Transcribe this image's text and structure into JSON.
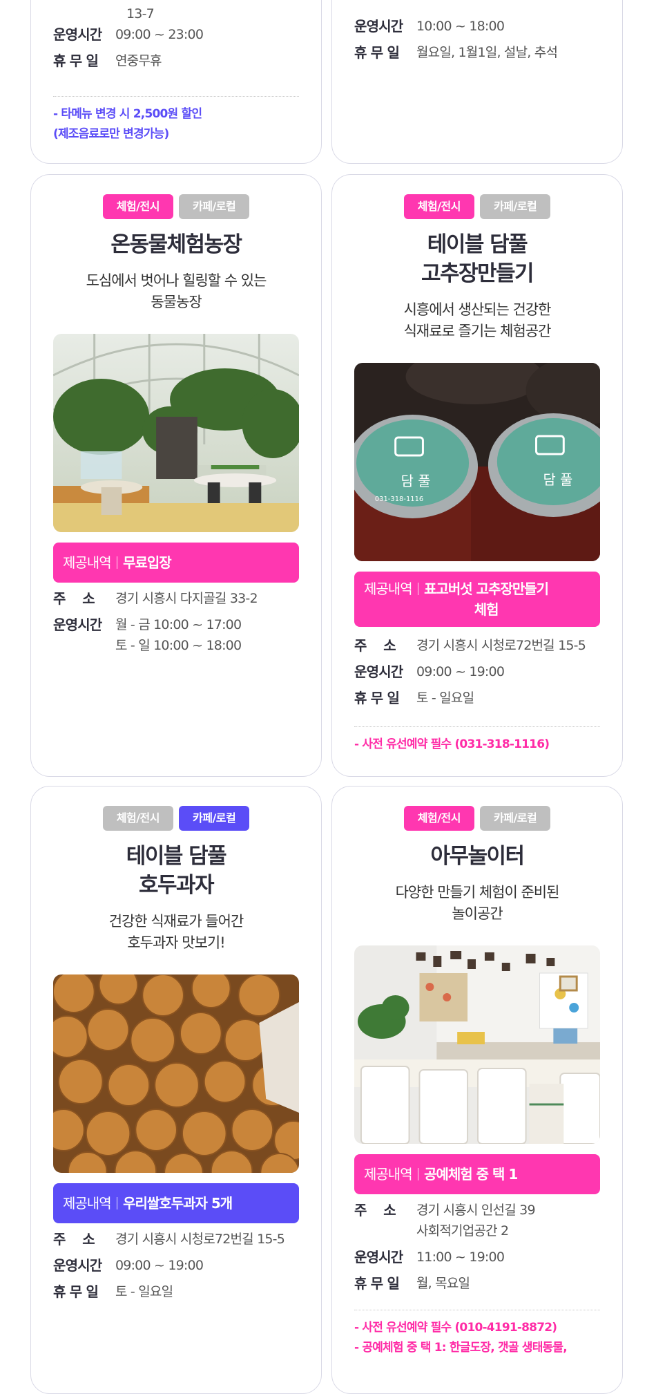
{
  "card1": {
    "address_tail": "13-7",
    "hours_label": "운영시간",
    "hours": "09:00 ~ 23:00",
    "closed_label": "휴 무 일",
    "closed": "연중무휴",
    "note": "- 타메뉴 변경 시 2,500원 할인\n(제조음료로만 변경가능)"
  },
  "card2": {
    "hours_label": "운영시간",
    "hours": "10:00 ~ 18:00",
    "closed_label": "휴 무 일",
    "closed": "월요일, 1월1일, 설날, 추석"
  },
  "card3": {
    "tags": [
      "체험/전시",
      "카페/로컬"
    ],
    "title": "온동물체험농장",
    "subtitle": "도심에서 벗어나 힐링할 수 있는\n동물농장",
    "offer_label": "제공내역",
    "offer": "무료입장",
    "address_label": "주    소",
    "address": "경기 시흥시 다지골길 33-2",
    "hours_label": "운영시간",
    "hours": "월 - 금 10:00 ~ 17:00\n토 - 일 10:00 ~ 18:00",
    "photo_alt": "greenhouse animal farm interior"
  },
  "card4": {
    "tags": [
      "체험/전시",
      "카페/로컬"
    ],
    "title": "테이블 담풀\n고추장만들기",
    "subtitle": "시흥에서 생산되는 건강한\n식재료로 즐기는 체험공간",
    "offer_label": "제공내역",
    "offer": "표고버섯 고추장만들기\n체험",
    "address_label": "주    소",
    "address": "경기 시흥시 시청로72번길 15-5",
    "hours_label": "운영시간",
    "hours": "09:00 ~ 19:00",
    "closed_label": "휴 무 일",
    "closed": "토 - 일요일",
    "note": "- 사전 유선예약 필수 (031-318-1116)",
    "jar_label": "담 풀",
    "jar_phone": "031-318-1116"
  },
  "card5": {
    "tags": [
      "체험/전시",
      "카페/로컬"
    ],
    "title": "테이블 담풀\n호두과자",
    "subtitle": "건강한 식재료가 들어간\n호두과자 맛보기!",
    "offer_label": "제공내역",
    "offer": "우리쌀호두과자 5개",
    "address_label": "주    소",
    "address": "경기 시흥시 시청로72번길 15-5",
    "hours_label": "운영시간",
    "hours": "09:00 ~ 19:00",
    "closed_label": "휴 무 일",
    "closed": "토 - 일요일"
  },
  "card6": {
    "tags": [
      "체험/전시",
      "카페/로컬"
    ],
    "title": "아무놀이터",
    "subtitle": "다양한 만들기 체험이 준비된\n놀이공간",
    "offer_label": "제공내역",
    "offer": "공예체험 중 택 1",
    "address_label": "주    소",
    "address": "경기 시흥시 인선길 39\n사회적기업공간 2",
    "hours_label": "운영시간",
    "hours": "11:00 ~ 19:00",
    "closed_label": "휴 무 일",
    "closed": "월, 목요일",
    "note": "- 사전 유선예약 필수 (010-4191-8872)\n- 공예체험 중 택 1: 한글도장, 갯골 생태동물,"
  },
  "colors": {
    "pink": "#ff37b0",
    "blue": "#5b4df7",
    "gray": "#bfbfbf",
    "border": "#d9d9e6"
  }
}
